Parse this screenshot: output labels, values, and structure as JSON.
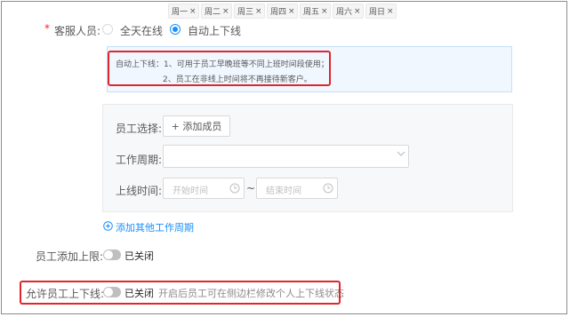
{
  "customer_service": {
    "required_mark": "*",
    "label": "客服人员:",
    "options": [
      {
        "label": "全天在线",
        "checked": false
      },
      {
        "label": "自动上下线",
        "checked": true
      }
    ]
  },
  "info": {
    "line1": "自动上下线：1、可用于员工早晚班等不同上班时间段使用；",
    "line2": "2、员工在非线上时间将不再接待新客户。"
  },
  "schedule": {
    "employee_label": "员工选择:",
    "add_member_label": "+ 添加成员",
    "period_label": "工作周期:",
    "days": [
      "周一",
      "周二",
      "周三",
      "周四",
      "周五",
      "周六",
      "周日"
    ],
    "online_time_label": "上线时间:",
    "start_placeholder": "开始时间",
    "tilde": "~",
    "end_placeholder": "结束时间"
  },
  "add_period_link": "添加其他工作周期",
  "limit": {
    "label": "员工添加上限:",
    "switch_text": "已关闭",
    "enabled": false
  },
  "allow_online": {
    "label": "允许员工上下线:",
    "switch_text": "已关闭",
    "enabled": false,
    "hint": "开启后员工可在侧边栏修改个人上下线状态"
  },
  "colors": {
    "primary": "#1890ff",
    "required": "#f5222d",
    "highlight_box": "#e0252b",
    "switch_off": "#bfbfbf"
  }
}
